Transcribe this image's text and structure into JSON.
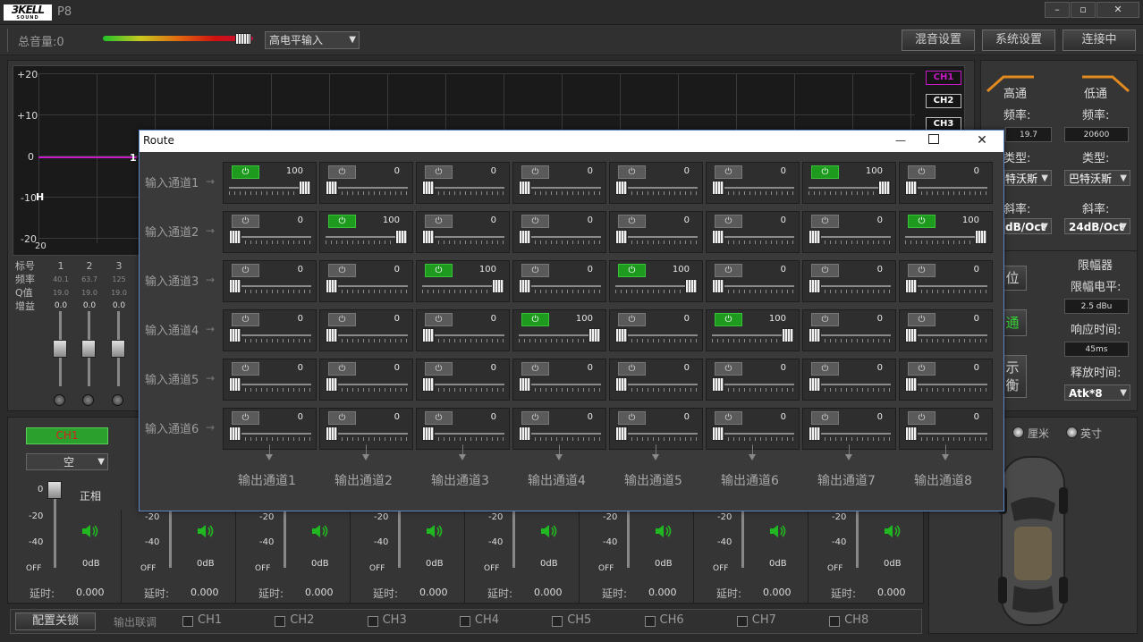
{
  "app": {
    "logo_text": "3KELL",
    "logo_sub": "SOUND",
    "title": "P8"
  },
  "toolbar": {
    "master_volume_label": "总音量:0",
    "input_mode": "高电平输入",
    "mix_settings": "混音设置",
    "system_settings": "系统设置",
    "connection_status": "连接中"
  },
  "graph": {
    "y_ticks": [
      "+20",
      "+10",
      "0",
      "-10",
      "-20"
    ],
    "x_start": "20",
    "channels": [
      "CH1",
      "CH2",
      "CH3"
    ]
  },
  "eq_labels": {
    "index": "标号",
    "freq": "频率",
    "q": "Q值",
    "gain": "增益"
  },
  "eq_bands": [
    {
      "index": "1",
      "freq": "40.1",
      "q": "19.0",
      "gain": "0.0"
    },
    {
      "index": "2",
      "freq": "63.7",
      "q": "19.0",
      "gain": "0.0"
    },
    {
      "index": "3",
      "freq": "125",
      "q": "19.0",
      "gain": "0.0"
    }
  ],
  "right_panel": {
    "highpass": "高通",
    "lowpass": "低通",
    "freq_label": "频率:",
    "hp_freq": "19.7",
    "lp_freq": "20600",
    "type_label": "类型:",
    "hp_type": "特沃斯",
    "lp_type": "巴特沃斯",
    "slope_label": "斜率:",
    "hp_slope": "dB/Oct",
    "lp_slope": "24dB/Oct",
    "btn_reset": "位",
    "btn_link": "通",
    "btn_show_1": "示",
    "btn_show_2": "衡",
    "limiter_title": "限幅器",
    "limiter_level_label": "限幅电平:",
    "limiter_level": "2.5 dBu",
    "attack_label": "响应时间:",
    "attack_value": "45ms",
    "release_label": "释放时间:",
    "release_value": "Atk*8",
    "unit_cm": "厘米",
    "unit_inch": "英寸"
  },
  "ch1_strip": {
    "name": "CH1",
    "mode": "空",
    "phase": "正相",
    "gain": "0dB",
    "scale": [
      "0",
      "-20",
      "-40",
      "OFF"
    ],
    "delay_label": "延时:",
    "delay_value": "0.000"
  },
  "strips": [
    {
      "gain": "0dB",
      "delay_label": "延时:",
      "delay_value": "0.000"
    },
    {
      "gain": "0dB",
      "delay_label": "延时:",
      "delay_value": "0.000"
    },
    {
      "gain": "0dB",
      "delay_label": "延时:",
      "delay_value": "0.000"
    },
    {
      "gain": "0dB",
      "delay_label": "延时:",
      "delay_value": "0.000"
    },
    {
      "gain": "0dB",
      "delay_label": "延时:",
      "delay_value": "0.000"
    },
    {
      "gain": "0dB",
      "delay_label": "延时:",
      "delay_value": "0.000"
    },
    {
      "gain": "0dB",
      "delay_label": "延时:",
      "delay_value": "0.000"
    }
  ],
  "strip_scale": [
    "-20",
    "-40",
    "OFF"
  ],
  "bottom": {
    "lock_button": "配置关锁",
    "link_label": "输出联调",
    "channels": [
      "CH1",
      "CH2",
      "CH3",
      "CH4",
      "CH5",
      "CH6",
      "CH7",
      "CH8"
    ]
  },
  "dialog": {
    "title": "Route",
    "inputs": [
      "输入通道1",
      "输入通道2",
      "输入通道3",
      "输入通道4",
      "输入通道5",
      "输入通道6"
    ],
    "outputs": [
      "输出通道1",
      "输出通道2",
      "输出通道3",
      "输出通道4",
      "输出通道5",
      "输出通道6",
      "输出通道7",
      "输出通道8"
    ],
    "matrix": [
      [
        100,
        0,
        0,
        0,
        0,
        0,
        100,
        0
      ],
      [
        0,
        100,
        0,
        0,
        0,
        0,
        0,
        100
      ],
      [
        0,
        0,
        100,
        0,
        100,
        0,
        0,
        0
      ],
      [
        0,
        0,
        0,
        100,
        0,
        100,
        0,
        0
      ],
      [
        0,
        0,
        0,
        0,
        0,
        0,
        0,
        0
      ],
      [
        0,
        0,
        0,
        0,
        0,
        0,
        0,
        0
      ]
    ]
  }
}
